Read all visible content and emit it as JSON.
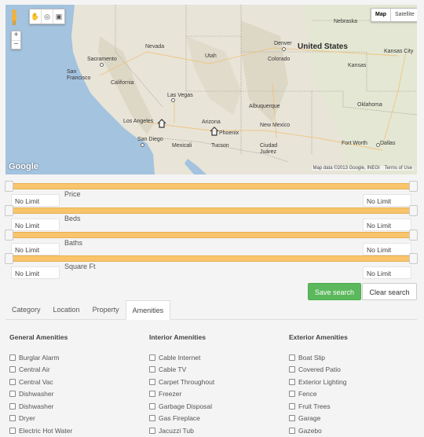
{
  "map": {
    "tool_icons": [
      "hand-icon",
      "circle-icon",
      "square-icon"
    ],
    "zoom_in": "+",
    "zoom_out": "−",
    "type_map": "Map",
    "type_satellite": "Satellite",
    "logo": "Google",
    "attribution": "Map data ©2013 Google, INEGI",
    "terms": "Terms of Use",
    "labels": {
      "nebraska": "Nebraska",
      "nevada": "Nevada",
      "utah": "Utah",
      "denver": "Denver",
      "united_states": "United States",
      "kansas_city": "Kansas City",
      "sacramento": "Sacramento",
      "san_francisco": "San\nFrancisco",
      "colorado": "Colorado",
      "kansas": "Kansas",
      "california": "California",
      "las_vegas": "Las Vegas",
      "albuquerque": "Albuquerque",
      "oklahoma": "Oklahoma",
      "los_angeles": "Los Angeles",
      "arizona": "Arizona",
      "phoenix": "Phoenix",
      "new_mexico": "New Mexico",
      "san_diego": "San Diego",
      "mexicali": "Mexicali",
      "tucson": "Tucson",
      "ciudad_juarez": "Ciudad\nJuárez",
      "fort_worth": "Fort Worth",
      "dallas": "Dallas"
    }
  },
  "filters": [
    {
      "label": "Price",
      "min": "No Limit",
      "max": "No Limit"
    },
    {
      "label": "Beds",
      "min": "No Limit",
      "max": "No Limit"
    },
    {
      "label": "Baths",
      "min": "No Limit",
      "max": "No Limit"
    },
    {
      "label": "Square Ft",
      "min": "No Limit",
      "max": "No Limit"
    }
  ],
  "buttons": {
    "save": "Save search",
    "clear": "Clear search"
  },
  "tabs": [
    {
      "label": "Category",
      "active": false
    },
    {
      "label": "Location",
      "active": false
    },
    {
      "label": "Property",
      "active": false
    },
    {
      "label": "Amenities",
      "active": true
    }
  ],
  "amenities": {
    "general": {
      "title": "General Amenities",
      "items": [
        "Burglar Alarm",
        "Central Air",
        "Central Vac",
        "Dishwasher",
        "Dishwasher",
        "Dryer",
        "Electric Hot Water"
      ]
    },
    "interior": {
      "title": "Interior Amenities",
      "items": [
        "Cable Internet",
        "Cable TV",
        "Carpet Throughout",
        "Freezer",
        "Garbage Disposal",
        "Gas Fireplace",
        "Jacuzzi Tub"
      ]
    },
    "exterior": {
      "title": "Exterior Amenities",
      "items": [
        "Boat Slip",
        "Covered Patio",
        "Exterior Lighting",
        "Fence",
        "Fruit Trees",
        "Garage",
        "Gazebo"
      ]
    }
  },
  "colors": {
    "slider": "#f8c46c",
    "save_button": "#5cb85c",
    "ocean": "#a3c3df"
  }
}
